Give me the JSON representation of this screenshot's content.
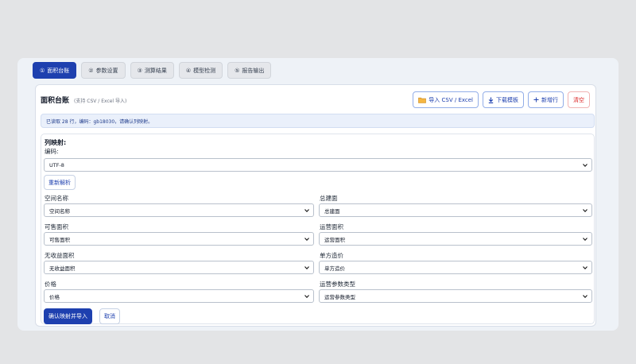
{
  "tabs": [
    {
      "num": "①",
      "label": "面积台账"
    },
    {
      "num": "②",
      "label": "参数设置"
    },
    {
      "num": "③",
      "label": "测算结果"
    },
    {
      "num": "④",
      "label": "模型检测"
    },
    {
      "num": "⑤",
      "label": "报告输出"
    }
  ],
  "card": {
    "title": "面积台账",
    "subtitle": "(支持 CSV / Excel 导入)",
    "actions": {
      "import": "导入 CSV / Excel",
      "download": "下载模板",
      "add_row": "新增行",
      "clear": "清空"
    },
    "notice": "已读取 28 行，编码：gb18030，请确认列映射。"
  },
  "mapping": {
    "title": "列映射:",
    "encoding_label": "编码:",
    "encoding_value": "UTF-8",
    "reparse": "重新解析",
    "fields": {
      "space_name": {
        "label": "空间名称",
        "value": "空间名称"
      },
      "total_area": {
        "label": "总建面",
        "value": "总建面"
      },
      "sellable_area": {
        "label": "可售面积",
        "value": "可售面积"
      },
      "operating_area": {
        "label": "运营面积",
        "value": "运营面积"
      },
      "nonrevenue_area": {
        "label": "无收益面积",
        "value": "无收益面积"
      },
      "unit_cost": {
        "label": "单方造价",
        "value": "单方造价"
      },
      "price": {
        "label": "价格",
        "value": "价格"
      },
      "operating_param_type": {
        "label": "运营参数类型",
        "value": "运营参数类型"
      }
    },
    "confirm": "确认映射并导入",
    "cancel": "取消"
  },
  "colors": {
    "primary": "#1e40af",
    "danger": "#dc2626",
    "notice_bg": "#eaf0fb"
  },
  "icons": {
    "import": "folder-icon",
    "download": "download-arrow-icon",
    "add_row": "plus-icon",
    "select": "chevron-down-icon"
  }
}
